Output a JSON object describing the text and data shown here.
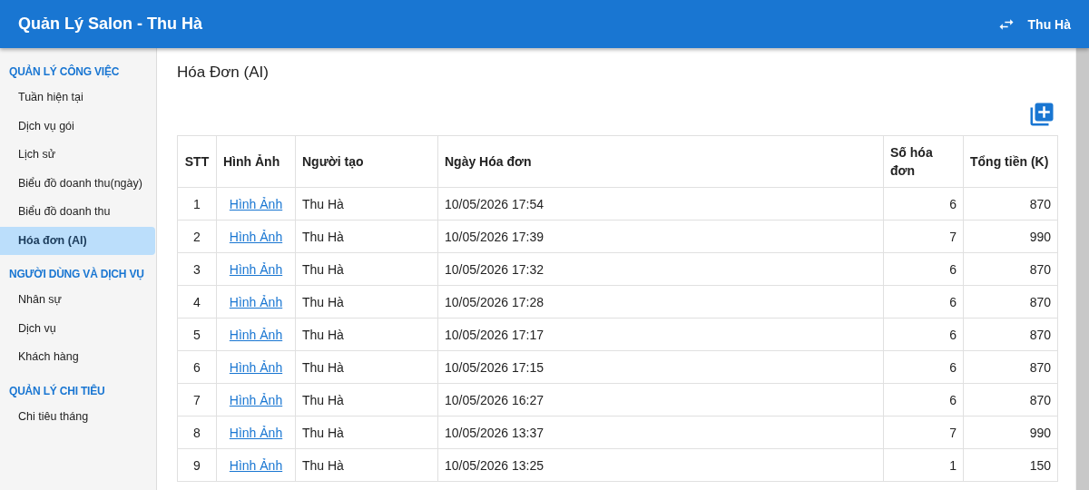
{
  "app_bar": {
    "title": "Quản Lý Salon - Thu Hà",
    "user": "Thu Hà"
  },
  "sidebar": {
    "sections": [
      {
        "heading": "QUẢN LÝ CÔNG VIỆC",
        "items": [
          {
            "label": "Tuần hiện tại",
            "selected": false
          },
          {
            "label": "Dịch vụ gói",
            "selected": false
          },
          {
            "label": "Lịch sử",
            "selected": false
          },
          {
            "label": "Biểu đồ doanh thu(ngày)",
            "selected": false
          },
          {
            "label": "Biểu đồ doanh thu",
            "selected": false
          },
          {
            "label": "Hóa đơn (AI)",
            "selected": true
          }
        ]
      },
      {
        "heading": "NGƯỜI DÙNG VÀ DỊCH VỤ",
        "items": [
          {
            "label": "Nhân sự",
            "selected": false
          },
          {
            "label": "Dịch vụ",
            "selected": false
          },
          {
            "label": "Khách hàng",
            "selected": false
          }
        ]
      },
      {
        "heading": "QUẢN LÝ CHI TIÊU",
        "items": [
          {
            "label": "Chi tiêu tháng",
            "selected": false
          }
        ]
      }
    ]
  },
  "page": {
    "title": "Hóa Đơn (AI)"
  },
  "table": {
    "columns": [
      "STT",
      "Hình Ảnh",
      "Người tạo",
      "Ngày Hóa đơn",
      "Số hóa đơn",
      "Tổng tiền (K)"
    ],
    "rows": [
      [
        "1",
        "Hình Ảnh",
        "Thu Hà",
        "10/05/2026 17:54",
        "6",
        "870"
      ],
      [
        "2",
        "Hình Ảnh",
        "Thu Hà",
        "10/05/2026 17:39",
        "7",
        "990"
      ],
      [
        "3",
        "Hình Ảnh",
        "Thu Hà",
        "10/05/2026 17:32",
        "6",
        "870"
      ],
      [
        "4",
        "Hình Ảnh",
        "Thu Hà",
        "10/05/2026 17:28",
        "6",
        "870"
      ],
      [
        "5",
        "Hình Ảnh",
        "Thu Hà",
        "10/05/2026 17:17",
        "6",
        "870"
      ],
      [
        "6",
        "Hình Ảnh",
        "Thu Hà",
        "10/05/2026 17:15",
        "6",
        "870"
      ],
      [
        "7",
        "Hình Ảnh",
        "Thu Hà",
        "10/05/2026 16:27",
        "6",
        "870"
      ],
      [
        "8",
        "Hình Ảnh",
        "Thu Hà",
        "10/05/2026 13:37",
        "7",
        "990"
      ],
      [
        "9",
        "Hình Ảnh",
        "Thu Hà",
        "10/05/2026 13:25",
        "1",
        "150"
      ]
    ]
  }
}
